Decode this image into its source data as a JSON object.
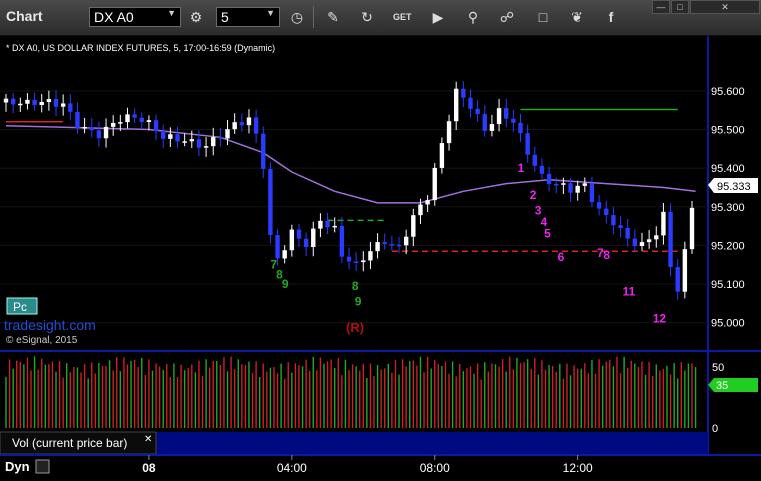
{
  "toolbar": {
    "app_title": "Chart",
    "symbol": "DX A0",
    "interval": "5",
    "icons": [
      "settings-icon",
      "clock-icon",
      "draw-icon",
      "refresh-icon",
      "get-icon",
      "play-icon",
      "link-icon",
      "chat-icon",
      "twitter-icon",
      "facebook-icon"
    ],
    "window_controls": [
      "—",
      "□",
      "✕"
    ]
  },
  "chart_data": {
    "type": "candlestick",
    "title": "* DX A0, US DOLLAR INDEX FUTURES, 5, 17:00-16:59 (Dynamic)",
    "watermark": "tradesight.com",
    "copyright": "© eSignal, 2015",
    "reversal_label": "(R)",
    "pc_badge": "Pc",
    "price_axis": {
      "ticks": [
        "95.600",
        "95.500",
        "95.400",
        "95.300",
        "95.200",
        "95.100",
        "95.000"
      ],
      "tick_values": [
        95.6,
        95.5,
        95.4,
        95.3,
        95.2,
        95.1,
        95.0
      ],
      "ylim": [
        94.95,
        95.68
      ],
      "last_price": "95.333",
      "last_price_value": 95.333
    },
    "time_axis": {
      "labels": [
        "08",
        "04:00",
        "08:00",
        "12:00"
      ],
      "label_bars": [
        20,
        40,
        60,
        80
      ]
    },
    "price_path": [
      [
        0,
        95.57
      ],
      [
        3,
        95.55
      ],
      [
        6,
        95.56
      ],
      [
        8,
        95.57
      ],
      [
        10,
        95.53
      ],
      [
        13,
        95.5
      ],
      [
        16,
        95.52
      ],
      [
        19,
        95.51
      ],
      [
        22,
        95.48
      ],
      [
        25,
        95.49
      ],
      [
        28,
        95.47
      ],
      [
        31,
        95.49
      ],
      [
        34,
        95.51
      ],
      [
        35,
        95.47
      ],
      [
        36,
        95.4
      ],
      [
        37,
        95.22
      ],
      [
        38,
        95.17
      ],
      [
        40,
        95.25
      ],
      [
        42,
        95.22
      ],
      [
        44,
        95.27
      ],
      [
        46,
        95.23
      ],
      [
        47,
        95.16
      ],
      [
        49,
        95.13
      ],
      [
        51,
        95.18
      ],
      [
        53,
        95.22
      ],
      [
        55,
        95.21
      ],
      [
        57,
        95.29
      ],
      [
        59,
        95.33
      ],
      [
        61,
        95.45
      ],
      [
        63,
        95.58
      ],
      [
        65,
        95.55
      ],
      [
        67,
        95.5
      ],
      [
        69,
        95.56
      ],
      [
        71,
        95.54
      ],
      [
        73,
        95.45
      ],
      [
        75,
        95.37
      ],
      [
        77,
        95.34
      ],
      [
        79,
        95.33
      ],
      [
        81,
        95.35
      ],
      [
        83,
        95.3
      ],
      [
        85,
        95.28
      ],
      [
        87,
        95.23
      ],
      [
        89,
        95.2
      ],
      [
        91,
        95.22
      ],
      [
        92,
        95.26
      ],
      [
        93,
        95.13
      ],
      [
        94,
        95.07
      ],
      [
        95,
        95.17
      ],
      [
        96,
        95.3
      ],
      [
        96.5,
        95.333
      ]
    ],
    "moving_average": [
      [
        0,
        95.51
      ],
      [
        20,
        95.5
      ],
      [
        30,
        95.48
      ],
      [
        36,
        95.44
      ],
      [
        40,
        95.39
      ],
      [
        46,
        95.34
      ],
      [
        52,
        95.31
      ],
      [
        58,
        95.31
      ],
      [
        64,
        95.34
      ],
      [
        70,
        95.36
      ],
      [
        76,
        95.37
      ],
      [
        84,
        95.36
      ],
      [
        92,
        95.35
      ],
      [
        96.5,
        95.34
      ]
    ],
    "levels": [
      {
        "name": "red-support-left",
        "y": 95.52,
        "x0": 0,
        "x1": 8,
        "color": "#dd2222"
      },
      {
        "name": "red-dashed-support",
        "y": 95.185,
        "x0": 54,
        "x1": 94,
        "color": "#dd2222"
      },
      {
        "name": "green-resistance",
        "y": 95.552,
        "x0": 72,
        "x1": 94,
        "color": "#22aa22"
      },
      {
        "name": "green-dashed-mid",
        "y": 95.265,
        "x0": 45,
        "x1": 53,
        "color": "#22aa22"
      }
    ],
    "td_counts": [
      {
        "text": "7",
        "bar": 37.0,
        "y": 95.14,
        "color": "#22aa22"
      },
      {
        "text": "8",
        "bar": 37.8,
        "y": 95.115,
        "color": "#22aa22"
      },
      {
        "text": "9",
        "bar": 38.6,
        "y": 95.09,
        "color": "#22aa22"
      },
      {
        "text": "8",
        "bar": 48.4,
        "y": 95.085,
        "color": "#22aa22"
      },
      {
        "text": "9",
        "bar": 48.8,
        "y": 95.045,
        "color": "#22aa22"
      },
      {
        "text": "1",
        "bar": 71.6,
        "y": 95.39,
        "color": "#ee22ee"
      },
      {
        "text": "2",
        "bar": 73.3,
        "y": 95.32,
        "color": "#ee22ee"
      },
      {
        "text": "3",
        "bar": 74.0,
        "y": 95.28,
        "color": "#ee22ee"
      },
      {
        "text": "4",
        "bar": 74.8,
        "y": 95.25,
        "color": "#ee22ee"
      },
      {
        "text": "5",
        "bar": 75.3,
        "y": 95.22,
        "color": "#ee22ee"
      },
      {
        "text": "6",
        "bar": 77.2,
        "y": 95.16,
        "color": "#ee22ee"
      },
      {
        "text": "7",
        "bar": 82.7,
        "y": 95.17,
        "color": "#ee22ee"
      },
      {
        "text": "8",
        "bar": 83.6,
        "y": 95.165,
        "color": "#ee22ee"
      },
      {
        "text": "11",
        "bar": 86.3,
        "y": 95.07,
        "color": "#ee22ee"
      },
      {
        "text": "12",
        "bar": 90.5,
        "y": 95.0,
        "color": "#ee22ee"
      }
    ],
    "volume": {
      "label": "Vol (current price bar)",
      "ticks": [
        "50",
        "0"
      ],
      "tick_values": [
        50,
        0
      ],
      "ylim": [
        0,
        60
      ],
      "current": "35",
      "current_value": 35
    },
    "bottom_label": "Dyn"
  }
}
